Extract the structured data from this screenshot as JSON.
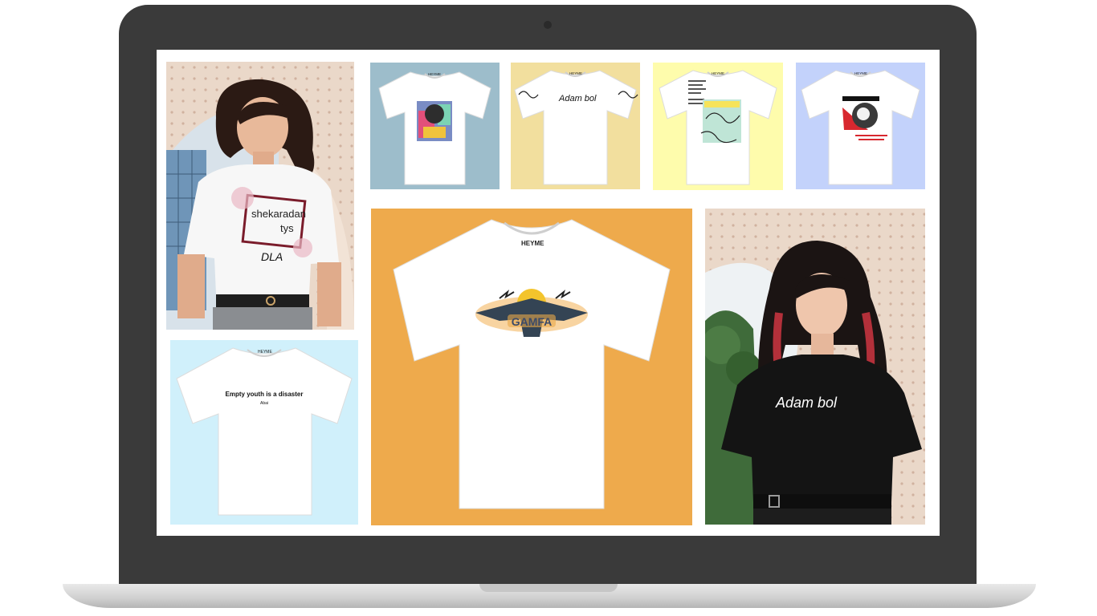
{
  "brand": "HEYME",
  "gallery": {
    "tile_1": {
      "print_line1": "shekaradan",
      "print_line2": "tys",
      "signature": "DLA"
    },
    "tile_2": {
      "bg": "#9dbdcb"
    },
    "tile_3": {
      "bg": "#f2df9e",
      "print_text": "Adam bol"
    },
    "tile_4": {
      "bg": "#fefcac"
    },
    "tile_5": {
      "bg": "#c3d2fb"
    },
    "tile_6": {
      "bg": "#d0f0fb",
      "print_text": "Empty youth is a disaster",
      "print_author": "Abai"
    },
    "tile_7": {
      "bg": "#eeaa4c",
      "print_text": "GAMFA"
    },
    "tile_8": {
      "print_text": "Adam bol"
    }
  }
}
